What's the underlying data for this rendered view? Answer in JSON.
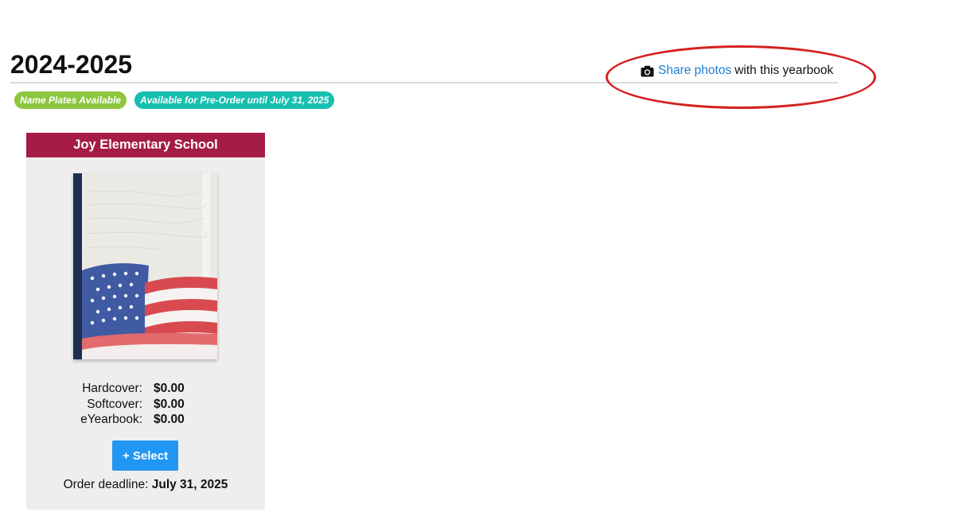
{
  "page": {
    "year_title": "2024-2025"
  },
  "share": {
    "link_text": "Share photos",
    "suffix_text": "with this yearbook",
    "icon": "camera-icon"
  },
  "badges": [
    {
      "label": "Name Plates Available",
      "color": "#8cc63f"
    },
    {
      "label": "Available for Pre-Order until July 31, 2025",
      "color": "#17bfae"
    }
  ],
  "card": {
    "school_name": "Joy Elementary School",
    "header_color": "#a51d44",
    "prices": [
      {
        "label": "Hardcover:",
        "value": "$0.00"
      },
      {
        "label": "Softcover:",
        "value": "$0.00"
      },
      {
        "label": "eYearbook:",
        "value": "$0.00"
      }
    ],
    "select_label": "+ Select",
    "deadline_label": "Order deadline:",
    "deadline_value": "July 31, 2025"
  },
  "colors": {
    "link": "#1a7fd6",
    "button": "#2196f3",
    "annotation": "#d62020"
  }
}
